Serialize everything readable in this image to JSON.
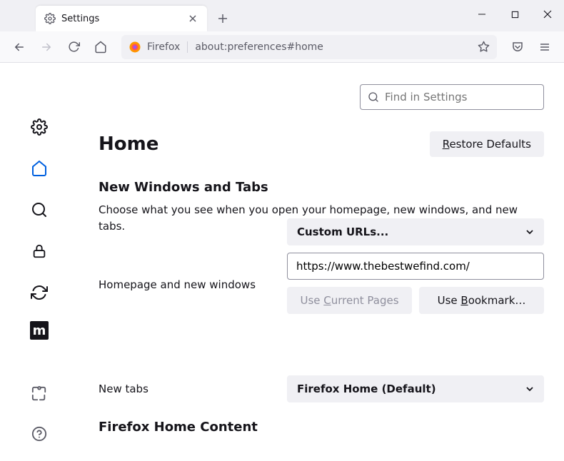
{
  "window": {
    "tab_title": "Settings",
    "urlbar_label": "Firefox",
    "urlbar_text": "about:preferences#home"
  },
  "search": {
    "placeholder": "Find in Settings"
  },
  "page": {
    "title": "Home",
    "restore_btn_pre": "R",
    "restore_btn_rest": "estore Defaults",
    "section1_title": "New Windows and Tabs",
    "section1_desc": "Choose what you see when you open your homepage, new windows, and new tabs.",
    "homepage_label": "Homepage and new windows",
    "homepage_select": "Custom URLs...",
    "homepage_url": "https://www.thebestwefind.com/",
    "use_current_pre": "Use ",
    "use_current_key": "C",
    "use_current_rest": "urrent Pages",
    "use_bookmark_pre": "Use ",
    "use_bookmark_key": "B",
    "use_bookmark_rest": "ookmark…",
    "newtabs_label": "New tabs",
    "newtabs_select": "Firefox Home (Default)",
    "section2_title": "Firefox Home Content"
  },
  "ext_badge": "m"
}
